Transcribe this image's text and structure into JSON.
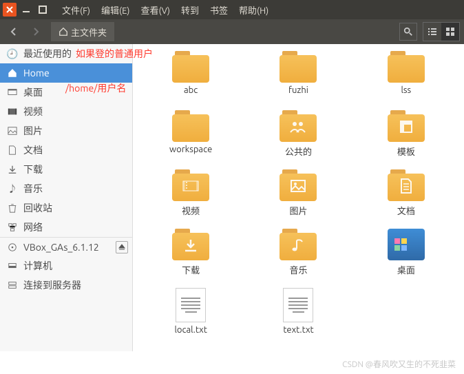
{
  "menubar": {
    "file": "文件(F)",
    "edit": "编辑(E)",
    "view": "查看(V)",
    "go": "转到",
    "bookmarks": "书签",
    "help": "帮助(H)"
  },
  "toolbar": {
    "location": "主文件夹"
  },
  "sidebar": {
    "items": [
      {
        "label": "最近使用的"
      },
      {
        "label": "Home"
      },
      {
        "label": "桌面"
      },
      {
        "label": "视频"
      },
      {
        "label": "图片"
      },
      {
        "label": "文档"
      },
      {
        "label": "下载"
      },
      {
        "label": "音乐"
      },
      {
        "label": "回收站"
      },
      {
        "label": "网络"
      },
      {
        "label": "VBox_GAs_6.1.12"
      },
      {
        "label": "计算机"
      },
      {
        "label": "连接到服务器"
      }
    ]
  },
  "files": [
    {
      "name": "abc",
      "type": "folder"
    },
    {
      "name": "fuzhi",
      "type": "folder"
    },
    {
      "name": "lss",
      "type": "folder"
    },
    {
      "name": "workspace",
      "type": "folder"
    },
    {
      "name": "公共的",
      "type": "folder",
      "glyph": "people"
    },
    {
      "name": "模板",
      "type": "folder",
      "glyph": "template"
    },
    {
      "name": "视频",
      "type": "folder",
      "glyph": "video"
    },
    {
      "name": "图片",
      "type": "folder",
      "glyph": "image"
    },
    {
      "name": "文档",
      "type": "folder",
      "glyph": "doc"
    },
    {
      "name": "下载",
      "type": "folder",
      "glyph": "download"
    },
    {
      "name": "音乐",
      "type": "folder",
      "glyph": "music"
    },
    {
      "name": "桌面",
      "type": "desktop"
    },
    {
      "name": "local.txt",
      "type": "text"
    },
    {
      "name": "text.txt",
      "type": "text"
    }
  ],
  "annotations": {
    "a1": "如果登的普通用户",
    "a2": "/home/用户名"
  },
  "watermark": "CSDN @春风吹又生的不死韭菜"
}
